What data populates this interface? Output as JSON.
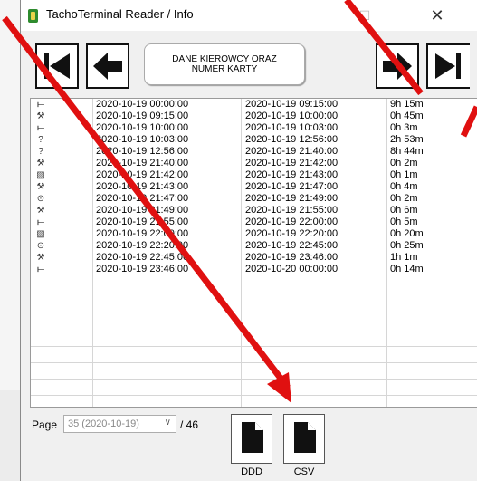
{
  "window": {
    "title": "TachoTerminal Reader / Info"
  },
  "toolbar": {
    "section_label": "DANE KIEROWCY ORAZ NUMER KARTY"
  },
  "table": {
    "rows": [
      {
        "icon": "⟝",
        "start": "2020-10-19 00:00:00",
        "end": "2020-10-19 09:15:00",
        "duration": "9h 15m"
      },
      {
        "icon": "⚒",
        "start": "2020-10-19 09:15:00",
        "end": "2020-10-19 10:00:00",
        "duration": "0h 45m"
      },
      {
        "icon": "⟝",
        "start": "2020-10-19 10:00:00",
        "end": "2020-10-19 10:03:00",
        "duration": "0h 3m"
      },
      {
        "icon": "?",
        "start": "2020-10-19 10:03:00",
        "end": "2020-10-19 12:56:00",
        "duration": "2h 53m"
      },
      {
        "icon": "?",
        "start": "2020-10-19 12:56:00",
        "end": "2020-10-19 21:40:00",
        "duration": "8h 44m"
      },
      {
        "icon": "⚒",
        "start": "2020-10-19 21:40:00",
        "end": "2020-10-19 21:42:00",
        "duration": "0h 2m"
      },
      {
        "icon": "▨",
        "start": "2020-10-19 21:42:00",
        "end": "2020-10-19 21:43:00",
        "duration": "0h 1m"
      },
      {
        "icon": "⚒",
        "start": "2020-10-19 21:43:00",
        "end": "2020-10-19 21:47:00",
        "duration": "0h 4m"
      },
      {
        "icon": "⊙",
        "start": "2020-10-19 21:47:00",
        "end": "2020-10-19 21:49:00",
        "duration": "0h 2m"
      },
      {
        "icon": "⚒",
        "start": "2020-10-19 21:49:00",
        "end": "2020-10-19 21:55:00",
        "duration": "0h 6m"
      },
      {
        "icon": "⟝",
        "start": "2020-10-19 21:55:00",
        "end": "2020-10-19 22:00:00",
        "duration": "0h 5m"
      },
      {
        "icon": "▨",
        "start": "2020-10-19 22:00:00",
        "end": "2020-10-19 22:20:00",
        "duration": "0h 20m"
      },
      {
        "icon": "⊙",
        "start": "2020-10-19 22:20:00",
        "end": "2020-10-19 22:45:00",
        "duration": "0h 25m"
      },
      {
        "icon": "⚒",
        "start": "2020-10-19 22:45:00",
        "end": "2020-10-19 23:46:00",
        "duration": "1h 1m"
      },
      {
        "icon": "⟝",
        "start": "2020-10-19 23:46:00",
        "end": "2020-10-20 00:00:00",
        "duration": "0h 14m"
      }
    ]
  },
  "pager": {
    "label": "Page",
    "selected": "35 (2020-10-19)",
    "total": "/ 46"
  },
  "export": {
    "ddd_label": "DDD",
    "csv_label": "CSV"
  },
  "colors": {
    "annotation_arrow": "#e01010"
  }
}
